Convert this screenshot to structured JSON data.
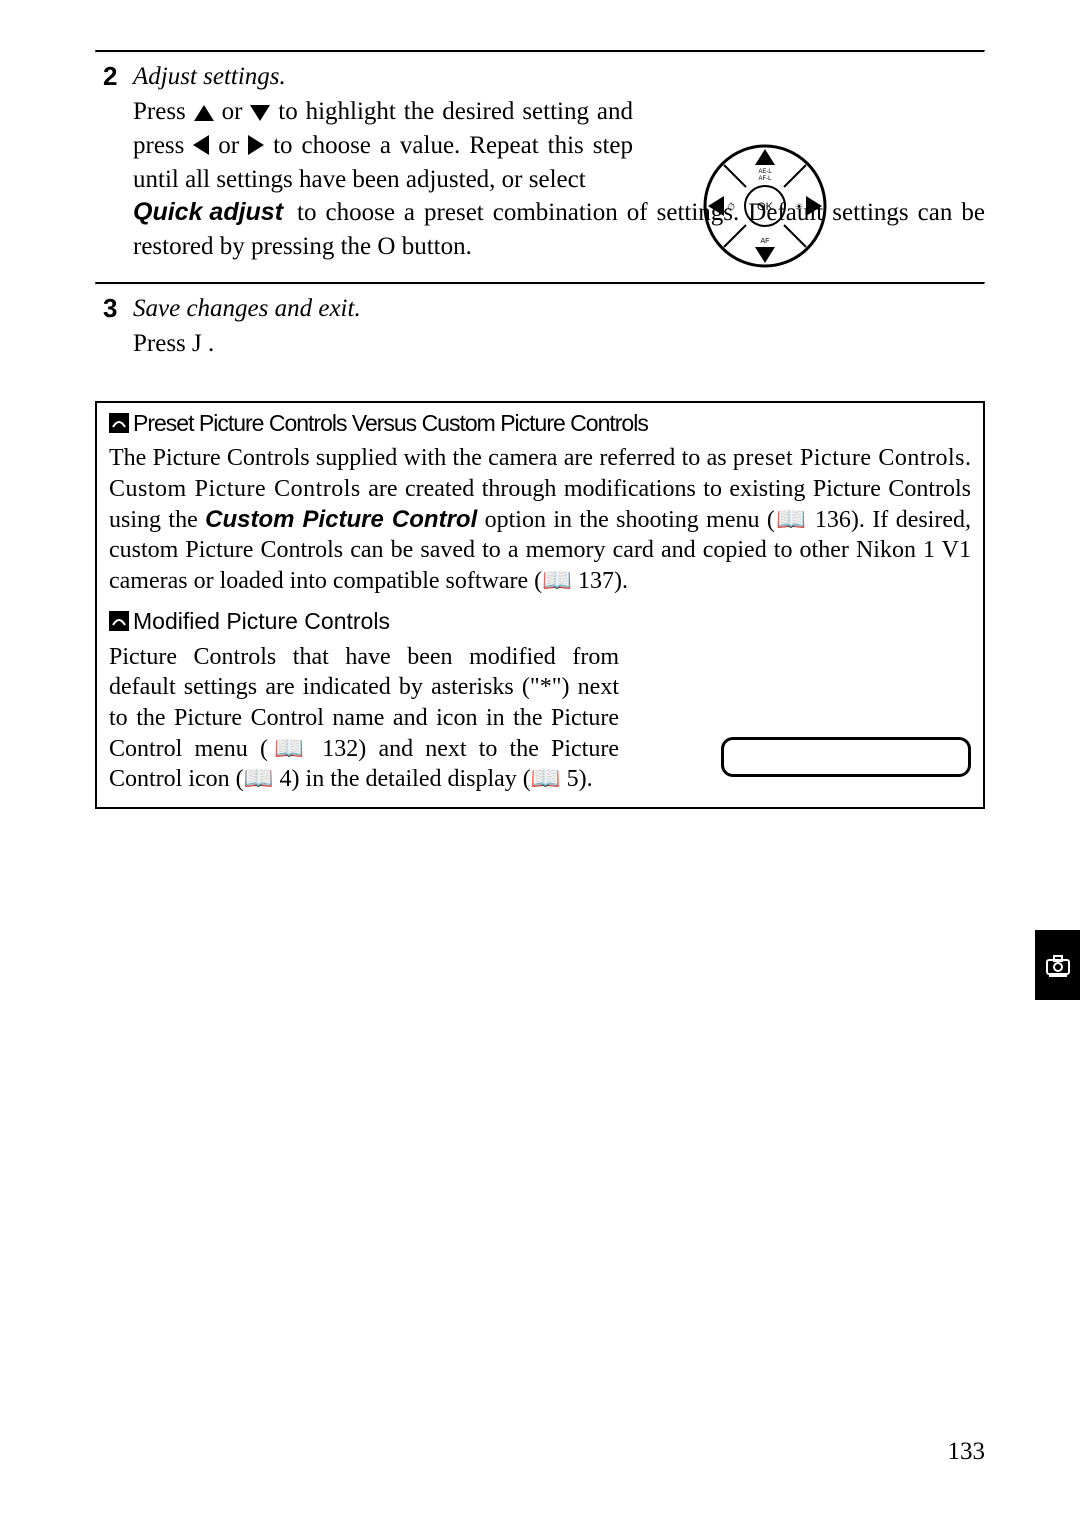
{
  "step2": {
    "number": "2",
    "title": "Adjust settings.",
    "line1_a": "Press ",
    "line1_b": " or ",
    "line1_c": " to highlight the desired setting and press ",
    "line1_d": " or ",
    "line1_e": " to choose a value. Repeat this step until all settings have been adjusted, or select ",
    "quick_label": "Quick adjust",
    "line2": " to choose a preset combination of settings. Default settings can be restored by pressing the O button."
  },
  "step3": {
    "number": "3",
    "title": "Save changes and exit.",
    "body": "Press J ."
  },
  "note1": {
    "title": "Preset Picture Controls Versus Custom Picture Controls",
    "body_a": "The Picture Controls supplied with the camera are referred to as ",
    "preset_word": "preset Picture Controls",
    "body_b": ". ",
    "custom_word": "Custom Picture Controls",
    "body_c": " are created through modifications to existing Picture Controls using the ",
    "cpc_label": "Custom Picture Control",
    "body_d": " option in the shooting menu (📖 136). If desired, custom Picture Controls can be saved to a memory card and copied to other Nikon 1 V1 cameras or loaded into compatible software (📖 137)."
  },
  "note2": {
    "title": "Modified Picture Controls",
    "body": "Picture Controls that have been modified from default settings are indicated by asterisks (\"*\") next to the Picture Control name and icon in the Picture Control menu (📖 132) and next to the Picture Control icon (📖 4) in the detailed display (📖 5)."
  },
  "page_number": "133",
  "multi_selector": {
    "top_label": "AE-L AF-L",
    "bottom_label": "AF",
    "center_label": "OK"
  }
}
